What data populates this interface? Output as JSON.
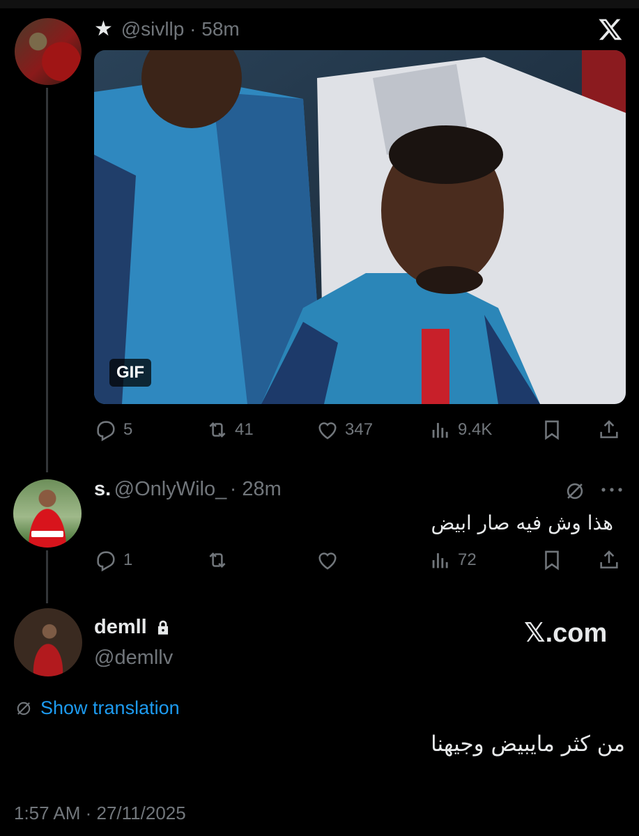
{
  "tweet1": {
    "handle": "@sivllp",
    "time": "58m",
    "media_badge": "GIF",
    "replies": "5",
    "reposts": "41",
    "likes": "347",
    "views": "9.4K"
  },
  "reply": {
    "name": "s.",
    "handle": "@OnlyWilo_",
    "time": "28m",
    "text": "هذا وش فيه صار ابيض",
    "replies": "1",
    "views": "72"
  },
  "main": {
    "name": "demll",
    "handle": "@demllv",
    "brand": "𝕏.com",
    "translate": "Show translation",
    "text": "من كثر مايبيض وجيهنا",
    "timestamp": "1:57 AM · 27/11/2025"
  },
  "colors": {
    "accent": "#1d9bf0",
    "muted": "#71767b",
    "text": "#e7e9ea",
    "bg": "#000000"
  },
  "icons": [
    "star-icon",
    "x-logo-icon",
    "reply-icon",
    "repost-icon",
    "like-icon",
    "views-icon",
    "bookmark-icon",
    "share-icon",
    "translate-icon",
    "more-icon",
    "lock-icon"
  ]
}
